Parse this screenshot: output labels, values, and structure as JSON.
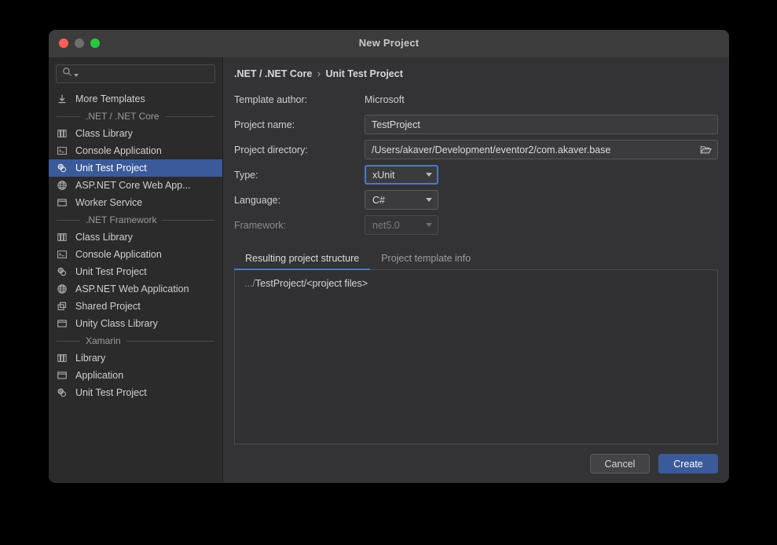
{
  "window": {
    "title": "New Project",
    "controls": [
      "close-button",
      "minimize-button",
      "maximize-button"
    ]
  },
  "colors": {
    "selection_blue": "#3a5a99",
    "accent_blue": "#4a79c8",
    "window_chrome": "#3c3c3c",
    "sidebar_bg": "#2b2b2b",
    "panel_bg": "#333336",
    "traffic_red": "#ff5f57",
    "traffic_gray": "#6e6e6e",
    "traffic_green": "#28c840"
  },
  "sidebar": {
    "search": {
      "value": "",
      "placeholder": "",
      "icon": "search-icon"
    },
    "items": [
      {
        "label": "More Templates",
        "icon": "download-icon",
        "type": "item",
        "selected": false
      },
      {
        "label": ".NET / .NET Core",
        "type": "group"
      },
      {
        "label": "Class Library",
        "icon": "library-icon",
        "type": "item",
        "selected": false
      },
      {
        "label": "Console Application",
        "icon": "console-icon",
        "type": "item",
        "selected": false
      },
      {
        "label": "Unit Test Project",
        "icon": "test-icon",
        "type": "item",
        "selected": true
      },
      {
        "label": "ASP.NET Core Web App...",
        "icon": "globe-icon",
        "type": "item",
        "selected": false
      },
      {
        "label": "Worker Service",
        "icon": "window-icon",
        "type": "item",
        "selected": false
      },
      {
        "label": ".NET Framework",
        "type": "group"
      },
      {
        "label": "Class Library",
        "icon": "library-icon",
        "type": "item",
        "selected": false
      },
      {
        "label": "Console Application",
        "icon": "console-icon",
        "type": "item",
        "selected": false
      },
      {
        "label": "Unit Test Project",
        "icon": "test-icon",
        "type": "item",
        "selected": false
      },
      {
        "label": "ASP.NET Web Application",
        "icon": "globe-icon",
        "type": "item",
        "selected": false
      },
      {
        "label": "Shared Project",
        "icon": "shared-icon",
        "type": "item",
        "selected": false
      },
      {
        "label": "Unity Class Library",
        "icon": "window-icon",
        "type": "item",
        "selected": false
      },
      {
        "label": "Xamarin",
        "type": "group"
      },
      {
        "label": "Library",
        "icon": "library-icon",
        "type": "item",
        "selected": false
      },
      {
        "label": "Application",
        "icon": "window-icon",
        "type": "item",
        "selected": false
      },
      {
        "label": "Unit Test Project",
        "icon": "test-icon",
        "type": "item",
        "selected": false
      }
    ]
  },
  "main": {
    "breadcrumb": {
      "root": ".NET / .NET Core",
      "separator": "›",
      "current": "Unit Test Project"
    },
    "fields": {
      "template_author": {
        "label": "Template author:",
        "value": "Microsoft"
      },
      "project_name": {
        "label": "Project name:",
        "value": "TestProject",
        "placeholder": ""
      },
      "project_directory": {
        "label": "Project directory:",
        "value": "/Users/akaver/Development/eventor2/com.akaver.base",
        "placeholder": "",
        "browse_icon": "folder-icon"
      },
      "type": {
        "label": "Type:",
        "value": "xUnit",
        "focused": true,
        "disabled": false
      },
      "language": {
        "label": "Language:",
        "value": "C#",
        "focused": false,
        "disabled": false
      },
      "framework": {
        "label": "Framework:",
        "value": "net5.0",
        "focused": false,
        "disabled": true
      }
    },
    "tabs": [
      {
        "label": "Resulting project structure",
        "active": true
      },
      {
        "label": "Project template info",
        "active": false
      }
    ],
    "result": {
      "prefix": ".../",
      "text": "TestProject/<project files>"
    },
    "buttons": {
      "cancel": "Cancel",
      "create": "Create"
    }
  }
}
